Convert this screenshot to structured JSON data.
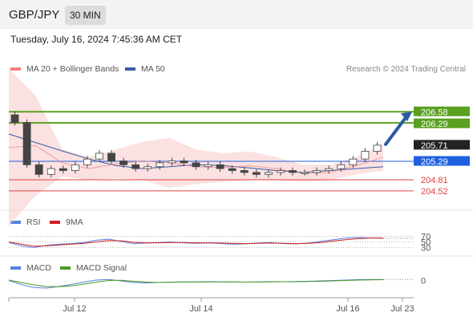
{
  "header": {
    "symbol": "GBP/JPY",
    "interval": "30 MIN"
  },
  "datetime": "Tuesday, July 16, 2024 7:45:36 AM CET",
  "legend": {
    "ma20": "MA 20 + Bollinger Bands",
    "ma50": "MA 50",
    "rsi": "RSI",
    "rsi_ma": "9MA",
    "macd": "MACD",
    "macd_signal": "MACD Signal"
  },
  "copyright": "Research © 2024 Trading Central",
  "colors": {
    "candle": "#444444",
    "bollinger": "#f8c8c8",
    "ma50": "#3a5aa8",
    "ma20": "#f08080",
    "resistance": "#5aa020",
    "pivot": "#2060e0",
    "support": "#e04040",
    "rsi": "#5580e0",
    "rsi_ma": "#d02020",
    "macd": "#5580e0",
    "macd_signal": "#4a9a20"
  },
  "chart_data": [
    {
      "type": "candlestick",
      "title": "GBP/JPY",
      "ylim": [
        204.1,
        207.4
      ],
      "price_labels": [
        {
          "label": "206.58",
          "role": "resistance"
        },
        {
          "label": "206.29",
          "role": "resistance"
        },
        {
          "label": "205.71",
          "role": "last_price"
        },
        {
          "label": "205.29",
          "role": "pivot"
        },
        {
          "label": "204.81",
          "role": "support"
        },
        {
          "label": "204.52",
          "role": "support"
        }
      ],
      "levels": [
        {
          "value": 206.58,
          "role": "resistance"
        },
        {
          "value": 206.29,
          "role": "resistance"
        },
        {
          "value": 205.29,
          "role": "pivot"
        },
        {
          "value": 204.81,
          "role": "support"
        },
        {
          "value": 204.52,
          "role": "support"
        }
      ],
      "x_ticks": [
        "Jul 12",
        "Jul 14",
        "Jul 16",
        "Jul 23"
      ],
      "ma50": [
        206.0,
        205.78,
        205.56,
        205.35,
        205.18,
        205.1,
        205.15,
        205.2,
        205.18,
        205.12,
        205.05,
        205.0,
        205.05,
        205.1,
        205.15
      ],
      "bollinger_upper": [
        207.7,
        207.0,
        205.6,
        205.4,
        205.6,
        205.8,
        205.9,
        205.6,
        205.5,
        205.55,
        205.4,
        205.2,
        205.2,
        205.4,
        205.75
      ],
      "bollinger_lower": [
        203.6,
        204.4,
        204.9,
        204.8,
        204.85,
        204.8,
        204.6,
        204.7,
        204.75,
        204.8,
        204.8,
        204.75,
        204.8,
        204.95,
        205.05
      ],
      "close": [
        206.3,
        205.2,
        204.95,
        205.1,
        205.05,
        205.2,
        205.35,
        205.5,
        205.3,
        205.2,
        205.1,
        205.15,
        205.25,
        205.3,
        205.25,
        205.15,
        205.2,
        205.1,
        205.05,
        205.0,
        204.95,
        205.0,
        205.05,
        205.0,
        205.0,
        205.05,
        205.1,
        205.2,
        205.35,
        205.55,
        205.71
      ],
      "forecast_target": 206.58
    },
    {
      "type": "line",
      "title": "RSI",
      "ylim": [
        20,
        80
      ],
      "y_ticks": [
        "70",
        "50",
        "30"
      ],
      "series": [
        {
          "name": "RSI",
          "values": [
            48,
            36,
            30,
            38,
            42,
            44,
            48,
            56,
            60,
            52,
            44,
            46,
            48,
            50,
            47,
            45,
            47,
            44,
            42,
            43,
            46,
            48,
            44,
            43,
            46,
            52,
            58,
            64,
            66,
            64,
            63
          ]
        },
        {
          "name": "9MA",
          "values": [
            50,
            42,
            35,
            36,
            39,
            42,
            45,
            50,
            55,
            54,
            49,
            47,
            47,
            48,
            48,
            47,
            47,
            46,
            45,
            44,
            45,
            46,
            45,
            44,
            45,
            48,
            53,
            58,
            62,
            64,
            64
          ]
        }
      ]
    },
    {
      "type": "line",
      "title": "MACD",
      "ylim": [
        -0.5,
        0.3
      ],
      "y_ticks": [
        "0"
      ],
      "series": [
        {
          "name": "MACD",
          "values": [
            0.0,
            -0.2,
            -0.35,
            -0.38,
            -0.3,
            -0.2,
            -0.08,
            0.02,
            0.05,
            -0.02,
            -0.1,
            -0.12,
            -0.1,
            -0.08,
            -0.07,
            -0.07,
            -0.06,
            -0.07,
            -0.08,
            -0.08,
            -0.07,
            -0.06,
            -0.06,
            -0.05,
            -0.04,
            -0.02,
            0.0,
            0.02,
            0.04,
            0.05,
            0.05
          ]
        },
        {
          "name": "MACD Signal",
          "values": [
            0.02,
            -0.1,
            -0.22,
            -0.3,
            -0.31,
            -0.27,
            -0.18,
            -0.08,
            0.0,
            0.01,
            -0.04,
            -0.08,
            -0.1,
            -0.09,
            -0.08,
            -0.08,
            -0.07,
            -0.07,
            -0.07,
            -0.08,
            -0.08,
            -0.07,
            -0.06,
            -0.06,
            -0.05,
            -0.04,
            -0.02,
            0.0,
            0.02,
            0.03,
            0.04
          ]
        }
      ]
    }
  ]
}
